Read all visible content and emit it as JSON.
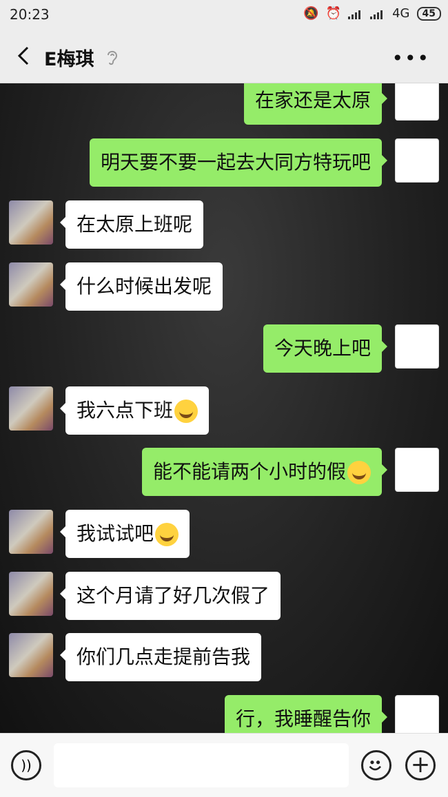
{
  "status_bar": {
    "time": "20:23",
    "network": "4G",
    "battery": "45"
  },
  "header": {
    "title": "E梅琪"
  },
  "messages": [
    {
      "side": "right",
      "text": "在家还是太原"
    },
    {
      "side": "right",
      "text": "明天要不要一起去大同方特玩吧"
    },
    {
      "side": "left",
      "text": "在太原上班呢"
    },
    {
      "side": "left",
      "text": "什么时候出发呢"
    },
    {
      "side": "right",
      "text": "今天晚上吧"
    },
    {
      "side": "left",
      "text": "我六点下班"
    },
    {
      "side": "right",
      "text": "能不能请两个小时的假"
    },
    {
      "side": "left",
      "text": "我试试吧"
    },
    {
      "side": "left",
      "text": "这个月请了好几次假了"
    },
    {
      "side": "left",
      "text": "你们几点走提前告我"
    },
    {
      "side": "right",
      "text": "行，我睡醒告你"
    }
  ],
  "input_bar": {
    "placeholder": ""
  },
  "icons": {
    "back": "chevron-left-icon",
    "ear": "ear-icon",
    "more": "more-icon",
    "voice": "voice-icon",
    "emoji": "emoji-icon",
    "plus": "plus-icon"
  },
  "colors": {
    "bubble_self": "#95ec69",
    "bubble_other": "#ffffff"
  }
}
